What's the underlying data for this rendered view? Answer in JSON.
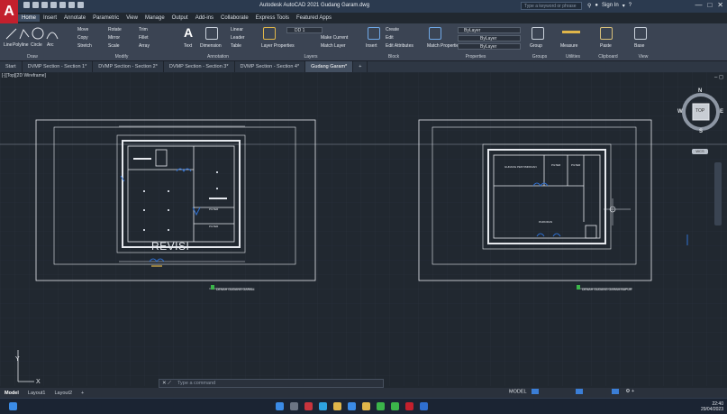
{
  "app": {
    "logo": "A",
    "window_title": "Autodesk AutoCAD 2021  Gudang Garam.dwg",
    "search_placeholder": "Type a keyword or phrase",
    "sign_in": "Sign In",
    "window_controls": [
      "—",
      "□",
      "✕"
    ]
  },
  "menu_tabs": [
    "Home",
    "Insert",
    "Annotate",
    "Parametric",
    "View",
    "Manage",
    "Output",
    "Add-ins",
    "Collaborate",
    "Express Tools",
    "Featured Apps"
  ],
  "ribbon": {
    "draw": {
      "title": "Draw",
      "tools": [
        "Line",
        "Polyline",
        "Circle",
        "Arc"
      ]
    },
    "modify": {
      "title": "Modify",
      "tools": [
        "Move",
        "Rotate",
        "Trim",
        "Copy",
        "Mirror",
        "Fillet",
        "Stretch",
        "Scale",
        "Array"
      ]
    },
    "annotation": {
      "title": "Annotation",
      "tools": [
        "Text",
        "Dimension",
        "Linear",
        "Leader",
        "Table"
      ]
    },
    "layers": {
      "title": "Layers",
      "tools": [
        "Layer Properties",
        "Make Current",
        "Match Layer"
      ],
      "current": "DD 1"
    },
    "block": {
      "title": "Block",
      "tools": [
        "Insert",
        "Create",
        "Edit",
        "Edit Attributes"
      ]
    },
    "properties": {
      "title": "Properties",
      "tools": [
        "Match Properties"
      ],
      "values": [
        "ByLayer",
        "ByLayer",
        "ByLayer"
      ]
    },
    "groups": {
      "title": "Groups",
      "tools": [
        "Group"
      ]
    },
    "utilities": {
      "title": "Utilities",
      "tools": [
        "Measure"
      ]
    },
    "clipboard": {
      "title": "Clipboard",
      "tools": [
        "Paste"
      ]
    },
    "view": {
      "title": "View",
      "tools": [
        "Base"
      ]
    }
  },
  "doc_tabs": [
    "Start",
    "DVMP Section - Section 1*",
    "DVMP Section - Section 2*",
    "DVMP Section - Section 3*",
    "DVMP Section - Section 4*",
    "Gudang Garam*"
  ],
  "viewport_label": "[-][Top][2D Wireframe]",
  "drawing": {
    "revisi_label": "REVISI",
    "left_title": "DENAH GUDANG GARAM",
    "right_title": "DENAH GUDANG GARAM BAPUR",
    "left_rooms": [
      "PILTER",
      "PILTER"
    ],
    "right_rooms": [
      "GUDANG PENYIMPANAN",
      "PILTER",
      "PILTER",
      "PARKIRAN"
    ]
  },
  "navcube": {
    "top": "TOP",
    "n": "N",
    "s": "S",
    "e": "E",
    "w": "W",
    "wcs": "WCS"
  },
  "ucs": {
    "x": "X",
    "y": "Y"
  },
  "command": {
    "placeholder": "Type a command"
  },
  "layout_tabs": [
    "Model",
    "Layout1",
    "Layout2",
    "+"
  ],
  "status": {
    "model": "MODEL"
  },
  "clock": {
    "time": "22:40",
    "date": "29/04/2023"
  },
  "colors": {
    "accent": "#c3202d",
    "background": "#212830",
    "grid": "#2a323d",
    "line": "#e6e9ee",
    "blue": "#2f6fd0"
  }
}
